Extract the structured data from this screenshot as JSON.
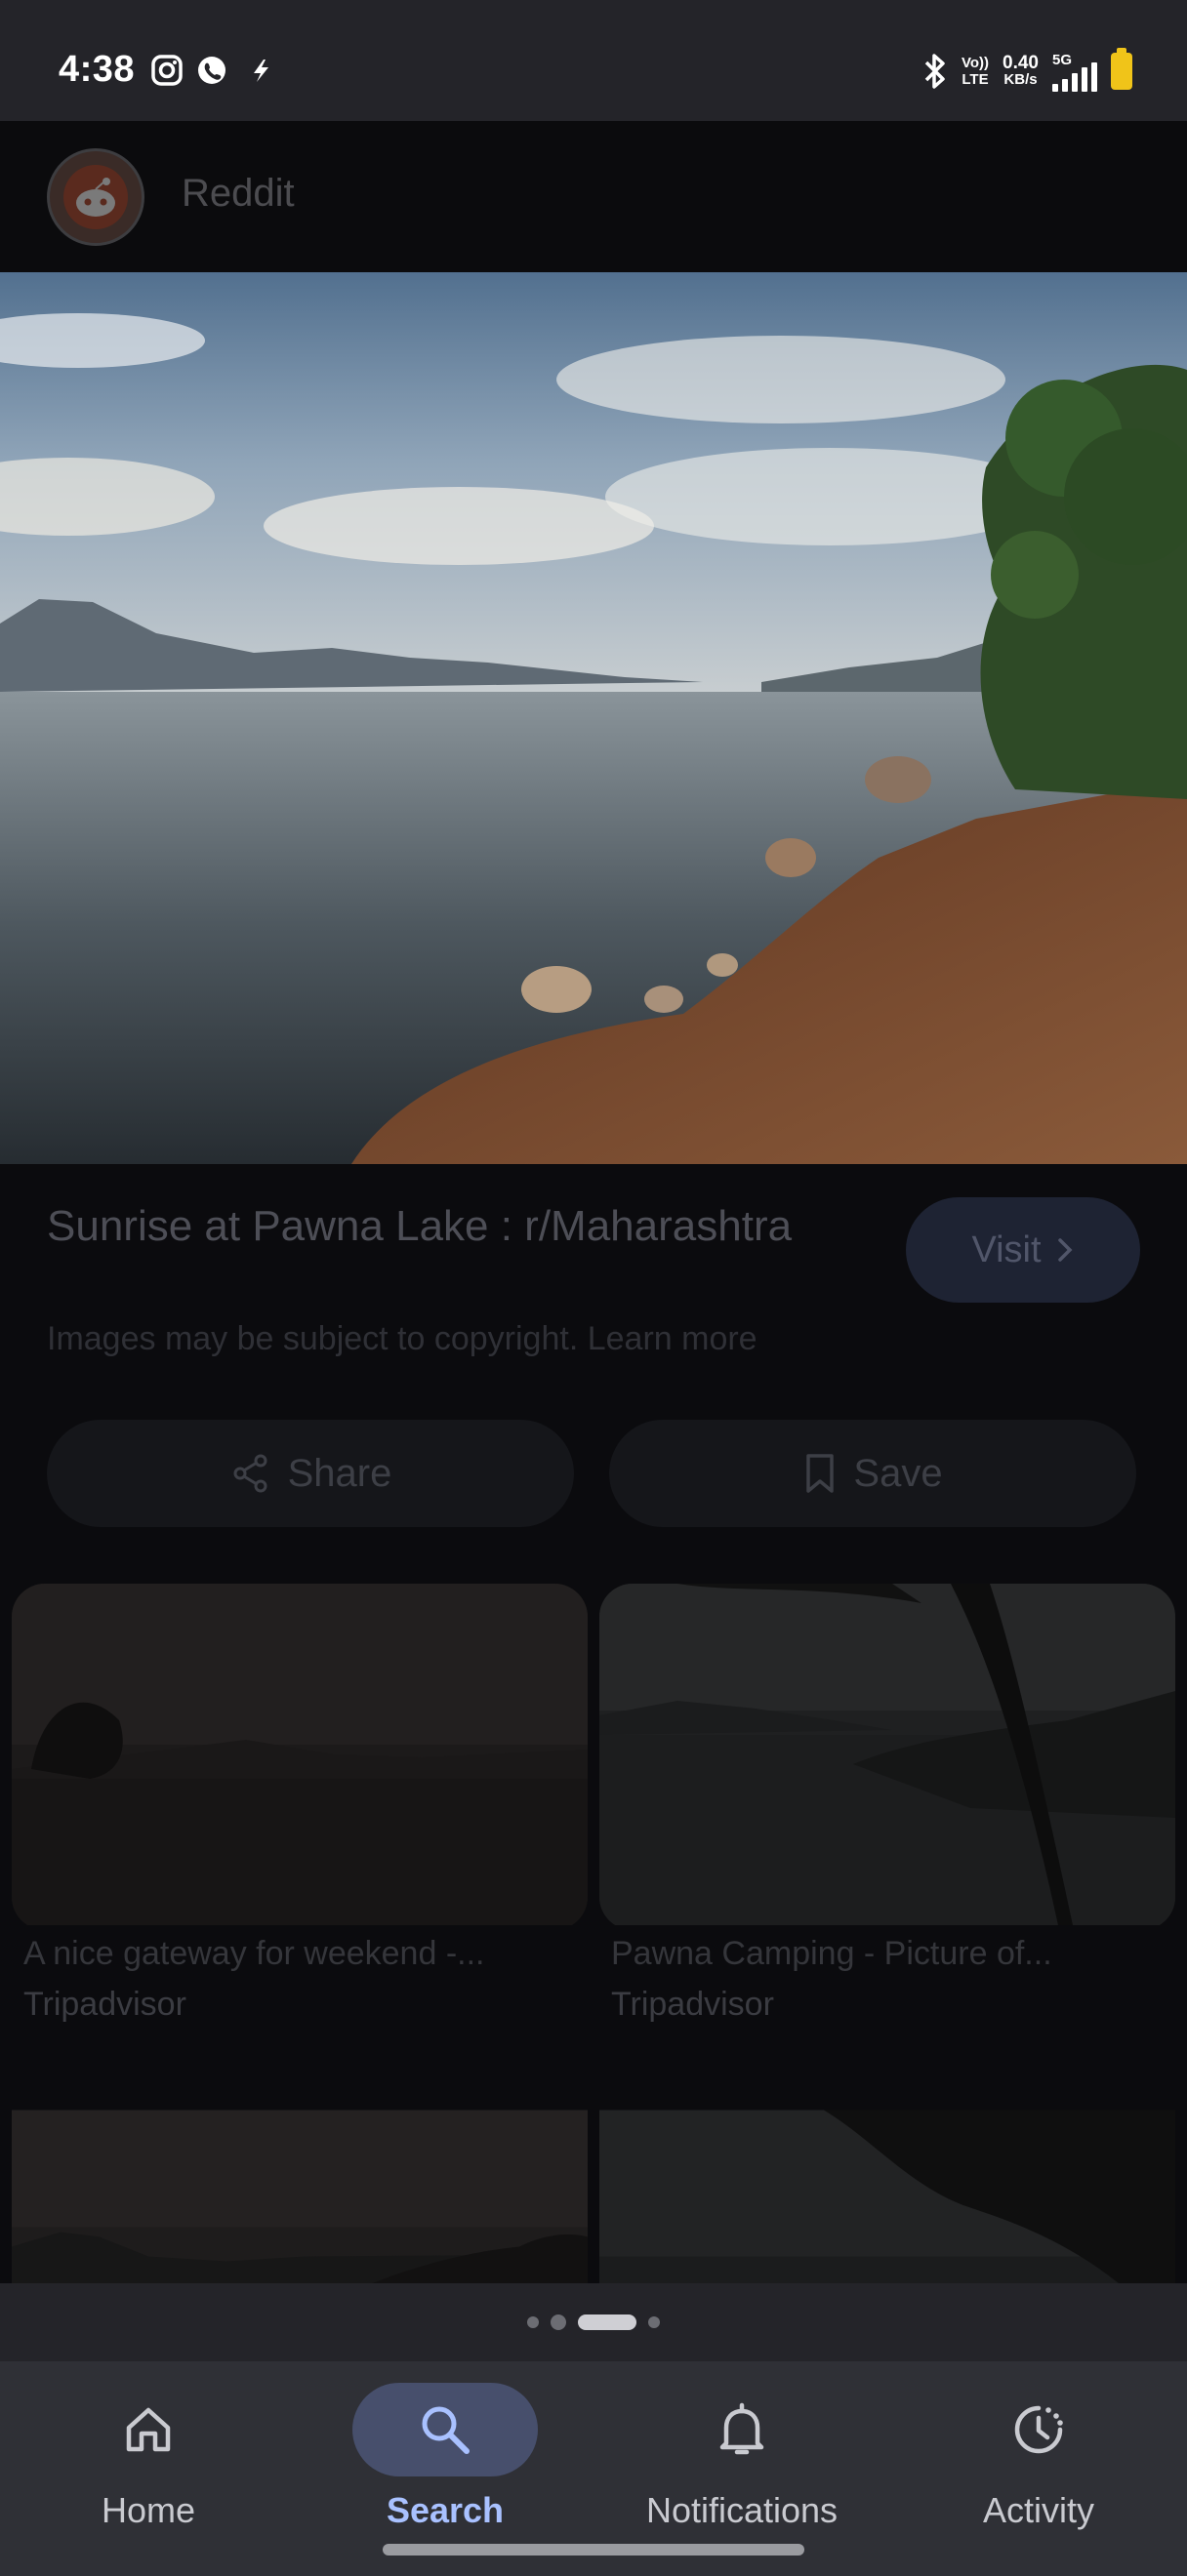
{
  "status_bar": {
    "time": "4:38",
    "left_icons": [
      "instagram-icon",
      "whatsapp-icon",
      "flash-icon"
    ],
    "network_top": "Vo))",
    "network_bottom": "LTE",
    "speed_value": "0.40",
    "speed_unit": "KB/s",
    "signal_label": "5G"
  },
  "header": {
    "source_name": "Reddit",
    "avatar_icon": "reddit-icon"
  },
  "result": {
    "title": "Sunrise at Pawna Lake : r/Maharashtra",
    "copyright_note": "Images may be subject to copyright. Learn more",
    "visit_label": "Visit",
    "share_label": "Share",
    "save_label": "Save"
  },
  "related": [
    {
      "caption": "A nice gateway for weekend -...",
      "source": "Tripadvisor"
    },
    {
      "caption": "Pawna Camping - Picture of...",
      "source": "Tripadvisor"
    },
    {
      "caption": "",
      "source": ""
    },
    {
      "caption": "",
      "source": ""
    }
  ],
  "page_indicator": {
    "count": 4,
    "active_index": 2
  },
  "bottom_nav": {
    "items": [
      {
        "label": "Home",
        "icon": "home-icon",
        "active": false
      },
      {
        "label": "Search",
        "icon": "search-icon",
        "active": true
      },
      {
        "label": "Notifications",
        "icon": "bell-icon",
        "active": false
      },
      {
        "label": "Activity",
        "icon": "activity-icon",
        "active": false
      }
    ]
  },
  "colors": {
    "background": "#242429",
    "nav_background": "#2f3036",
    "active_pill": "#474f6c",
    "active_label": "#a9c1ff",
    "battery": "#f0c419"
  }
}
